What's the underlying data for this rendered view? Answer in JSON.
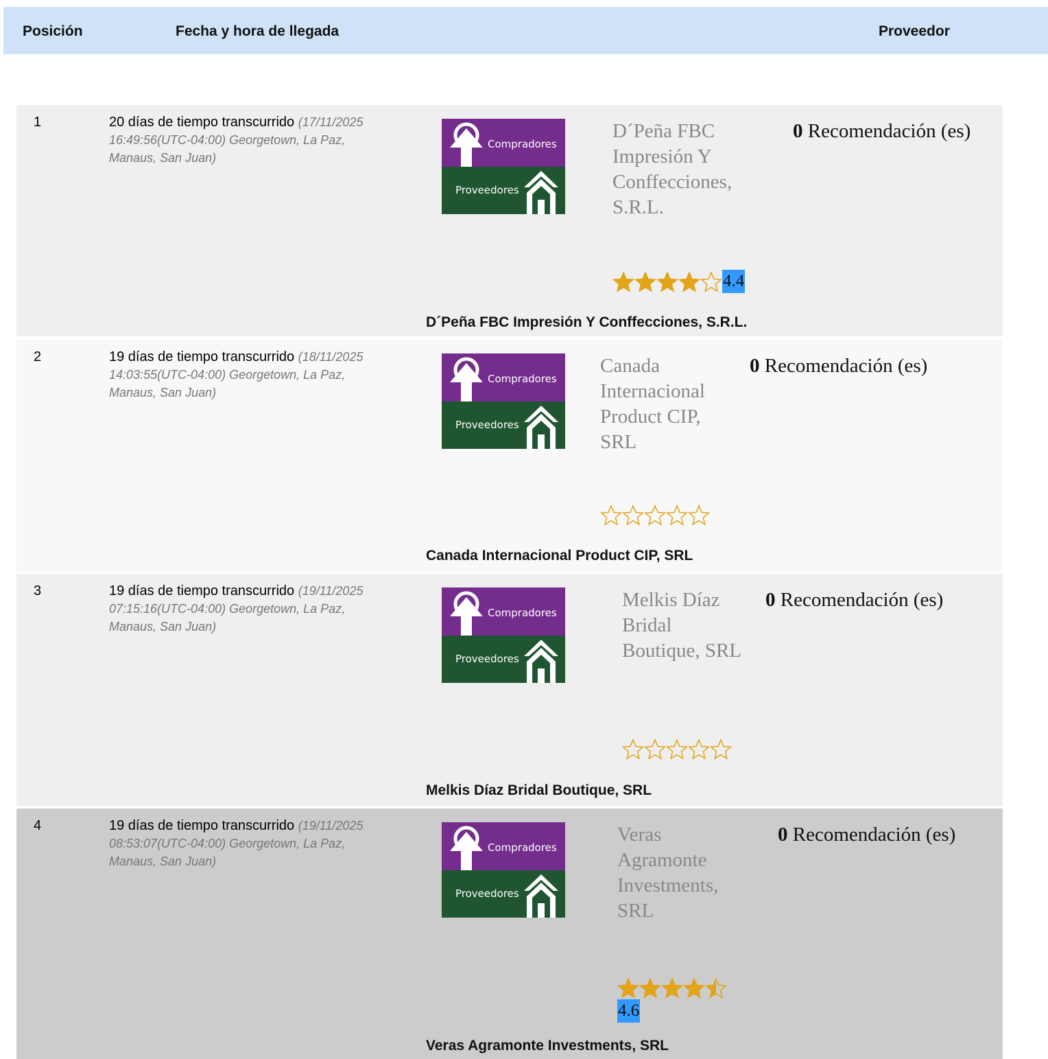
{
  "header": {
    "position": "Posición",
    "arrival": "Fecha y hora de llegada",
    "supplier": "Proveedor"
  },
  "logo": {
    "buyers": "Compradores",
    "suppliers": "Proveedores",
    "purple": "#742d8c",
    "green": "#1f5631"
  },
  "star_color": "#e2a418",
  "rating_highlight": "#3399ff",
  "rows": [
    {
      "position": "1",
      "elapsed": "20 días de tiempo transcurrido",
      "timestamp": "(17/11/2025 16:49:56(UTC-04:00) Georgetown, La Paz, Manaus, San Juan)",
      "supplier_name": "D´Peña FBC Impresión Y Conffecciones, S.R.L.",
      "recommendations": "0",
      "recommendations_label": "Recomendación (es)",
      "stars_filled": 4,
      "stars_half": false,
      "rating": "4.4",
      "bottom_name": "D´Peña FBC Impresión Y Conffecciones, S.R.L."
    },
    {
      "position": "2",
      "elapsed": "19 días de tiempo transcurrido",
      "timestamp": "(18/11/2025 14:03:55(UTC-04:00) Georgetown, La Paz, Manaus, San Juan)",
      "supplier_name": "Canada Internacional Product CIP, SRL",
      "recommendations": "0",
      "recommendations_label": "Recomendación (es)",
      "stars_filled": 0,
      "stars_half": false,
      "rating": "",
      "bottom_name": "Canada Internacional Product CIP, SRL"
    },
    {
      "position": "3",
      "elapsed": "19 días de tiempo transcurrido",
      "timestamp": "(19/11/2025 07:15:16(UTC-04:00) Georgetown, La Paz, Manaus, San Juan)",
      "supplier_name": "Melkis Díaz Bridal Boutique, SRL",
      "recommendations": "0",
      "recommendations_label": "Recomendación (es)",
      "stars_filled": 0,
      "stars_half": false,
      "rating": "",
      "bottom_name": "Melkis Díaz Bridal Boutique, SRL"
    },
    {
      "position": "4",
      "elapsed": "19 días de tiempo transcurrido",
      "timestamp": "(19/11/2025 08:53:07(UTC-04:00) Georgetown, La Paz, Manaus, San Juan)",
      "supplier_name": "Veras Agramonte Investments, SRL",
      "recommendations": "0",
      "recommendations_label": "Recomendación (es)",
      "stars_filled": 4,
      "stars_half": true,
      "rating": "4.6",
      "bottom_name": "Veras Agramonte Investments, SRL"
    }
  ]
}
